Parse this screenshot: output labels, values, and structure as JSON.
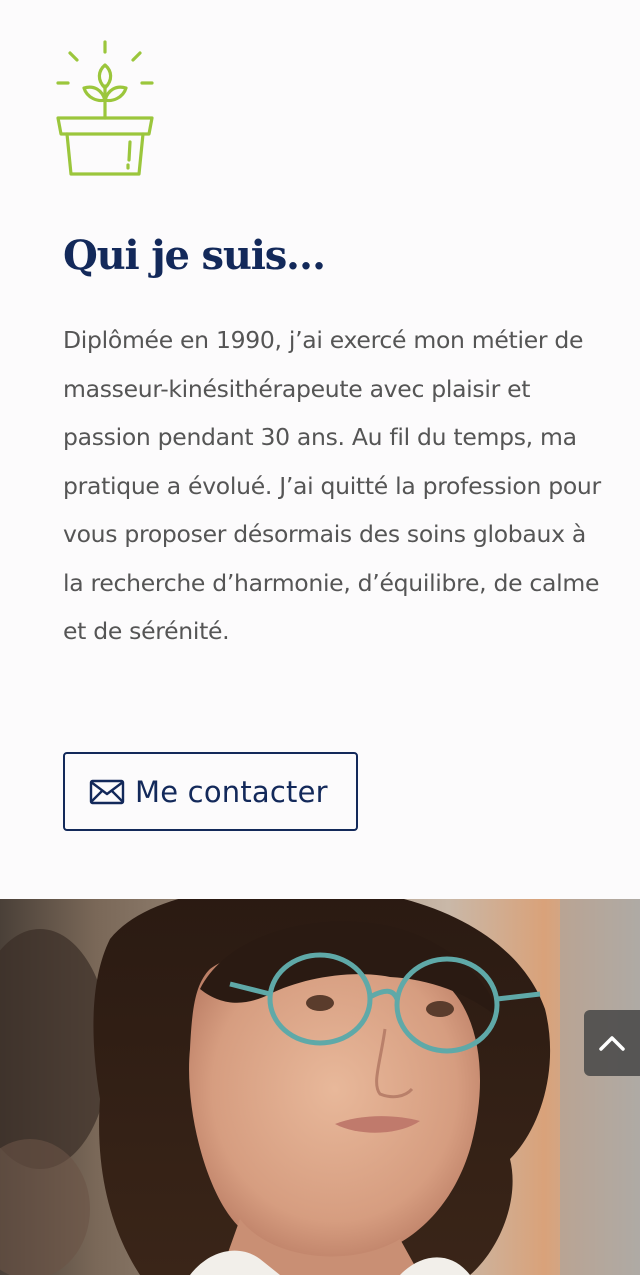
{
  "about": {
    "icon": "plant-pot-icon",
    "title": "Qui je suis…",
    "paragraph": "Diplômée en 1990, j’ai exercé mon métier de masseur-kinésithérapeute avec plaisir et passion pendant 30 ans. Au fil du temps, ma pratique a évolué. J’ai quitté la profession pour vous proposer désormais des soins globaux à la recherche d’harmonie, d’équilibre, de calme et de sérénité.",
    "contact_button": {
      "icon": "envelope-icon",
      "label": "Me contacter"
    }
  },
  "portrait": {
    "subject": "portrait of a smiling woman with glasses"
  },
  "scroll_top": {
    "icon": "chevron-up-icon"
  },
  "colors": {
    "background": "#fcfbfc",
    "title": "#13295a",
    "body_text": "#555555",
    "icon_green": "#9bc63c",
    "button_border": "#13295a"
  }
}
